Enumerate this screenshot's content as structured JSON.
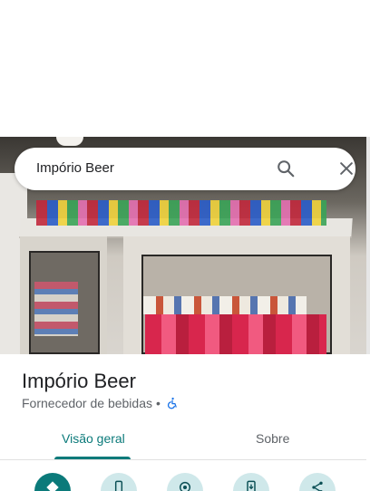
{
  "search": {
    "query": "Impório Beer"
  },
  "place": {
    "name": "Impório Beer",
    "category": "Fornecedor de bebidas",
    "separator": "•"
  },
  "tabs": [
    {
      "label": "Visão geral",
      "selected": true
    },
    {
      "label": "Sobre",
      "selected": false
    }
  ],
  "actions": [
    {
      "icon": "directions-icon",
      "primary": true
    },
    {
      "icon": "phone-icon",
      "primary": false
    },
    {
      "icon": "nearby-icon",
      "primary": false
    },
    {
      "icon": "send-to-phone-icon",
      "primary": false
    },
    {
      "icon": "share-icon",
      "primary": false
    }
  ],
  "colors": {
    "accent": "#0b7a7a",
    "action_bg": "#cfe8ea",
    "accessibility_blue": "#1a73e8"
  }
}
